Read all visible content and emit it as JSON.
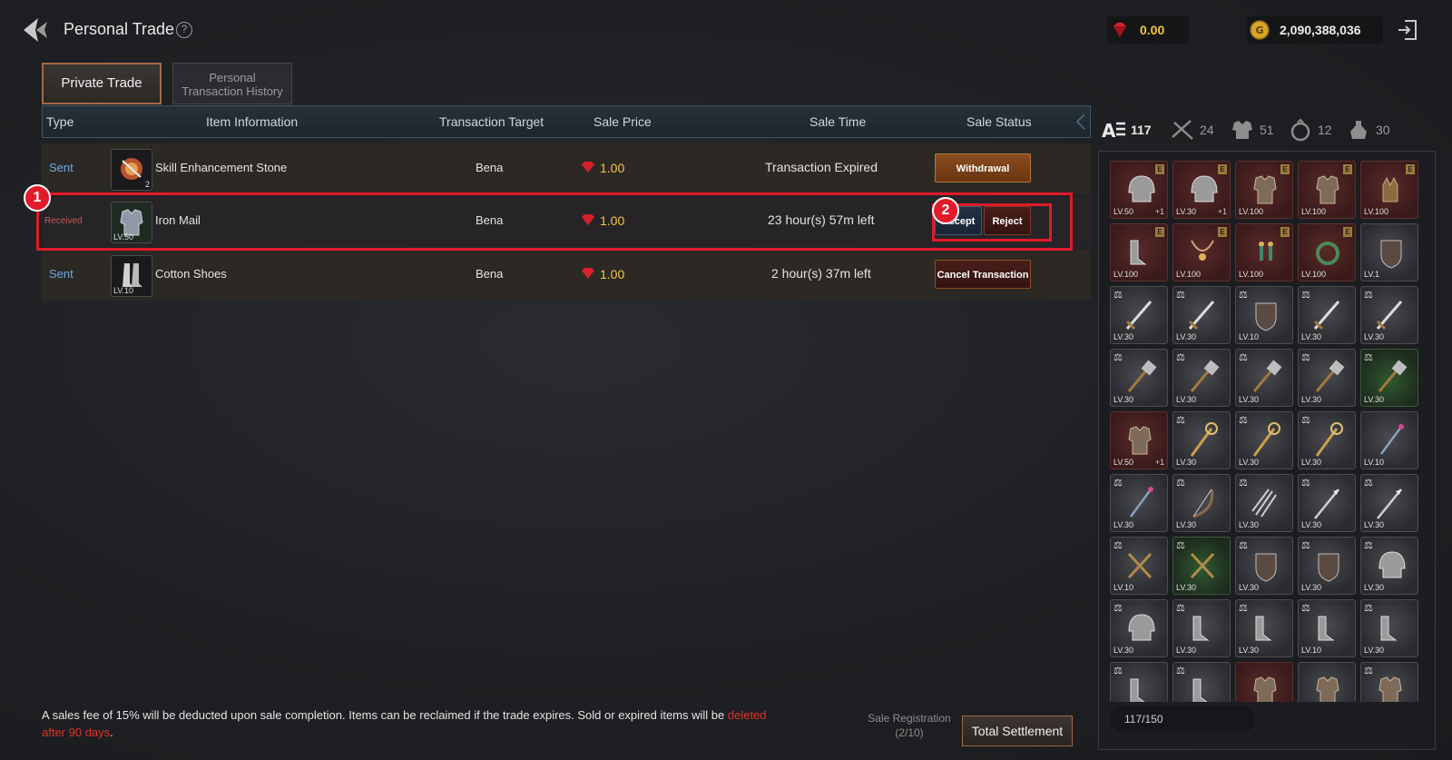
{
  "header": {
    "title": "Personal Trade",
    "help": "?",
    "ruby_amount": "0.00",
    "gold_amount": "2,090,388,036"
  },
  "tabs": [
    {
      "label": "Private Trade",
      "active": true
    },
    {
      "label_line1": "Personal",
      "label_line2": "Transaction History",
      "active": false
    }
  ],
  "table": {
    "columns": [
      "Type",
      "Item Information",
      "Transaction Target",
      "Sale Price",
      "Sale Time",
      "Sale Status"
    ],
    "rows": [
      {
        "type": "Sent",
        "item": "Skill Enhancement Stone",
        "icon": "stone-icon",
        "count": "2",
        "level": "",
        "target": "Bena",
        "price": "1.00",
        "time": "Transaction Expired",
        "action": "Withdrawal"
      },
      {
        "type": "Received",
        "item": "Iron Mail",
        "icon": "armor-icon",
        "count": "",
        "level": "LV.50",
        "target": "Bena",
        "price": "1.00",
        "time": "23 hour(s) 57m left",
        "action_accept": "Accept",
        "action_reject": "Reject"
      },
      {
        "type": "Sent",
        "item": "Cotton Shoes",
        "icon": "boots-icon",
        "count": "",
        "level": "LV.10",
        "target": "Bena",
        "price": "1.00",
        "time": "2 hour(s) 37m left",
        "action": "Cancel Transaction"
      }
    ]
  },
  "annotations": {
    "badge1": "1",
    "badge2": "2"
  },
  "footer": {
    "note_main": "A sales fee of 15% will be deducted upon sale completion. Items can be reclaimed if the trade expires. Sold or expired items will be ",
    "note_red_1": "deleted",
    "note_red_2": "after 90 days",
    "note_end": ".",
    "sale_registration_label": "Sale Registration",
    "sale_registration_value": "(2/10)",
    "total_settlement": "Total Settlement"
  },
  "inventory": {
    "filters": [
      {
        "icon": "all-items-icon",
        "count": "117",
        "active": true
      },
      {
        "icon": "weapon-icon",
        "count": "24"
      },
      {
        "icon": "armor-icon",
        "count": "51"
      },
      {
        "icon": "accessory-icon",
        "count": "12"
      },
      {
        "icon": "consumable-icon",
        "count": "30"
      }
    ],
    "capacity": "117/150",
    "slots": [
      {
        "lv": "LV.50",
        "style": "red",
        "e": true,
        "plus": "+1",
        "icon": "helmet"
      },
      {
        "lv": "LV.30",
        "style": "red",
        "e": true,
        "plus": "+1",
        "icon": "helmet"
      },
      {
        "lv": "LV.100",
        "style": "red",
        "e": true,
        "icon": "armor"
      },
      {
        "lv": "LV.100",
        "style": "red",
        "e": true,
        "icon": "armor"
      },
      {
        "lv": "LV.100",
        "style": "red",
        "e": true,
        "icon": "gloves"
      },
      {
        "lv": "LV.100",
        "style": "red",
        "e": true,
        "icon": "boots"
      },
      {
        "lv": "LV.100",
        "style": "red",
        "e": true,
        "icon": "necklace"
      },
      {
        "lv": "LV.100",
        "style": "red",
        "e": true,
        "icon": "earring"
      },
      {
        "lv": "LV.100",
        "style": "red",
        "e": true,
        "icon": "ring"
      },
      {
        "lv": "LV.1",
        "style": "",
        "icon": "shield"
      },
      {
        "lv": "LV.30",
        "style": "",
        "bal": true,
        "icon": "sword"
      },
      {
        "lv": "LV.30",
        "style": "",
        "bal": true,
        "icon": "sword"
      },
      {
        "lv": "LV.10",
        "style": "",
        "bal": true,
        "icon": "shield"
      },
      {
        "lv": "LV.30",
        "style": "",
        "bal": true,
        "icon": "sword"
      },
      {
        "lv": "LV.30",
        "style": "",
        "bal": true,
        "icon": "sword"
      },
      {
        "lv": "LV.30",
        "style": "",
        "bal": true,
        "icon": "mace"
      },
      {
        "lv": "LV.30",
        "style": "",
        "bal": true,
        "icon": "mace"
      },
      {
        "lv": "LV.30",
        "style": "",
        "bal": true,
        "icon": "mace"
      },
      {
        "lv": "LV.30",
        "style": "",
        "bal": true,
        "icon": "mace"
      },
      {
        "lv": "LV.30",
        "style": "green",
        "bal": true,
        "icon": "mace"
      },
      {
        "lv": "LV.50",
        "style": "red",
        "plus": "+1",
        "icon": "armor"
      },
      {
        "lv": "LV.30",
        "style": "",
        "bal": true,
        "icon": "staff"
      },
      {
        "lv": "LV.30",
        "style": "",
        "bal": true,
        "icon": "staff"
      },
      {
        "lv": "LV.30",
        "style": "",
        "bal": true,
        "icon": "staff"
      },
      {
        "lv": "LV.10",
        "style": "",
        "icon": "wand"
      },
      {
        "lv": "LV.30",
        "style": "",
        "bal": true,
        "icon": "wand"
      },
      {
        "lv": "LV.30",
        "style": "",
        "bal": true,
        "icon": "bow"
      },
      {
        "lv": "LV.30",
        "style": "",
        "bal": true,
        "icon": "claw"
      },
      {
        "lv": "LV.30",
        "style": "",
        "bal": true,
        "icon": "spear"
      },
      {
        "lv": "LV.30",
        "style": "",
        "bal": true,
        "icon": "spear"
      },
      {
        "lv": "LV.10",
        "style": "",
        "bal": true,
        "icon": "crossbow"
      },
      {
        "lv": "LV.30",
        "style": "green",
        "bal": true,
        "icon": "crossbow"
      },
      {
        "lv": "LV.30",
        "style": "",
        "bal": true,
        "icon": "shield"
      },
      {
        "lv": "LV.30",
        "style": "",
        "bal": true,
        "icon": "shield"
      },
      {
        "lv": "LV.30",
        "style": "",
        "bal": true,
        "icon": "helmet"
      },
      {
        "lv": "LV.30",
        "style": "",
        "bal": true,
        "icon": "helmet"
      },
      {
        "lv": "LV.30",
        "style": "",
        "bal": true,
        "icon": "boots"
      },
      {
        "lv": "LV.30",
        "style": "",
        "bal": true,
        "icon": "boots"
      },
      {
        "lv": "LV.10",
        "style": "",
        "bal": true,
        "icon": "boots"
      },
      {
        "lv": "LV.30",
        "style": "",
        "bal": true,
        "icon": "boots"
      },
      {
        "lv": "",
        "style": "",
        "bal": true,
        "icon": "boots"
      },
      {
        "lv": "",
        "style": "",
        "bal": true,
        "icon": "boots"
      },
      {
        "lv": "",
        "style": "red",
        "icon": "armor"
      },
      {
        "lv": "",
        "style": "",
        "icon": "armor"
      },
      {
        "lv": "",
        "style": "",
        "bal": true,
        "icon": "armor"
      }
    ]
  }
}
